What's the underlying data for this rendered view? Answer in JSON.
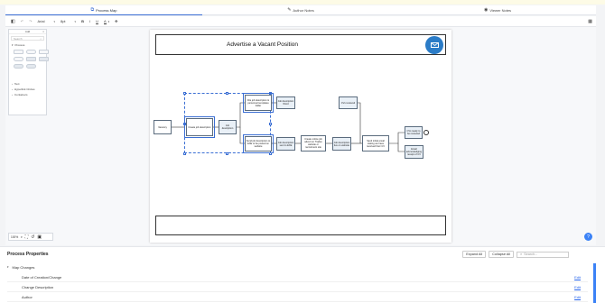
{
  "tabs": [
    {
      "label": "Process Map",
      "icon": "process-map-icon",
      "active": true
    },
    {
      "label": "Author Notes",
      "icon": "pencil-icon",
      "active": false
    },
    {
      "label": "Viewer Notes",
      "icon": "eye-icon",
      "active": false
    }
  ],
  "toolbar": {
    "font": "Arial",
    "size": "8pt",
    "bold": "B",
    "italic": "I",
    "underline": "U",
    "font_color": "A"
  },
  "shapes_panel": {
    "title": "Add",
    "search_placeholder": "Search",
    "sections": [
      "Process",
      "Text",
      "Hyperlink Circles",
      "Containers"
    ]
  },
  "diagram": {
    "title": "Advertise a Vacant Position",
    "nodes": [
      "Vacancy",
      "Create job description",
      "Job description",
      "File job description & personnel templates folder",
      "Job description Word",
      "Send job description to EXE to be posted on website",
      "Job description sent to EXE",
      "Create online job advert on Trades website or recruitment site",
      "Job description live on website",
      "CVs received",
      "Send initial email stating we have received their CV",
      "CVs ready to be reviewed",
      "Email acknowledging receipt of CV"
    ]
  },
  "zoom": {
    "level": "100%"
  },
  "properties": {
    "title": "Process Properties",
    "expand_all": "Expand All",
    "collapse_all": "Collapse All",
    "search_placeholder": "Search...",
    "group": "Map Changes",
    "rows": [
      {
        "label": "Date of Creation/Change",
        "action": "Edit"
      },
      {
        "label": "Change Description",
        "action": "Edit"
      },
      {
        "label": "Author",
        "action": "Edit"
      }
    ]
  },
  "colors": {
    "accent": "#3b6fd4",
    "mail_icon": "#2b7cc7",
    "link": "#2563eb"
  }
}
